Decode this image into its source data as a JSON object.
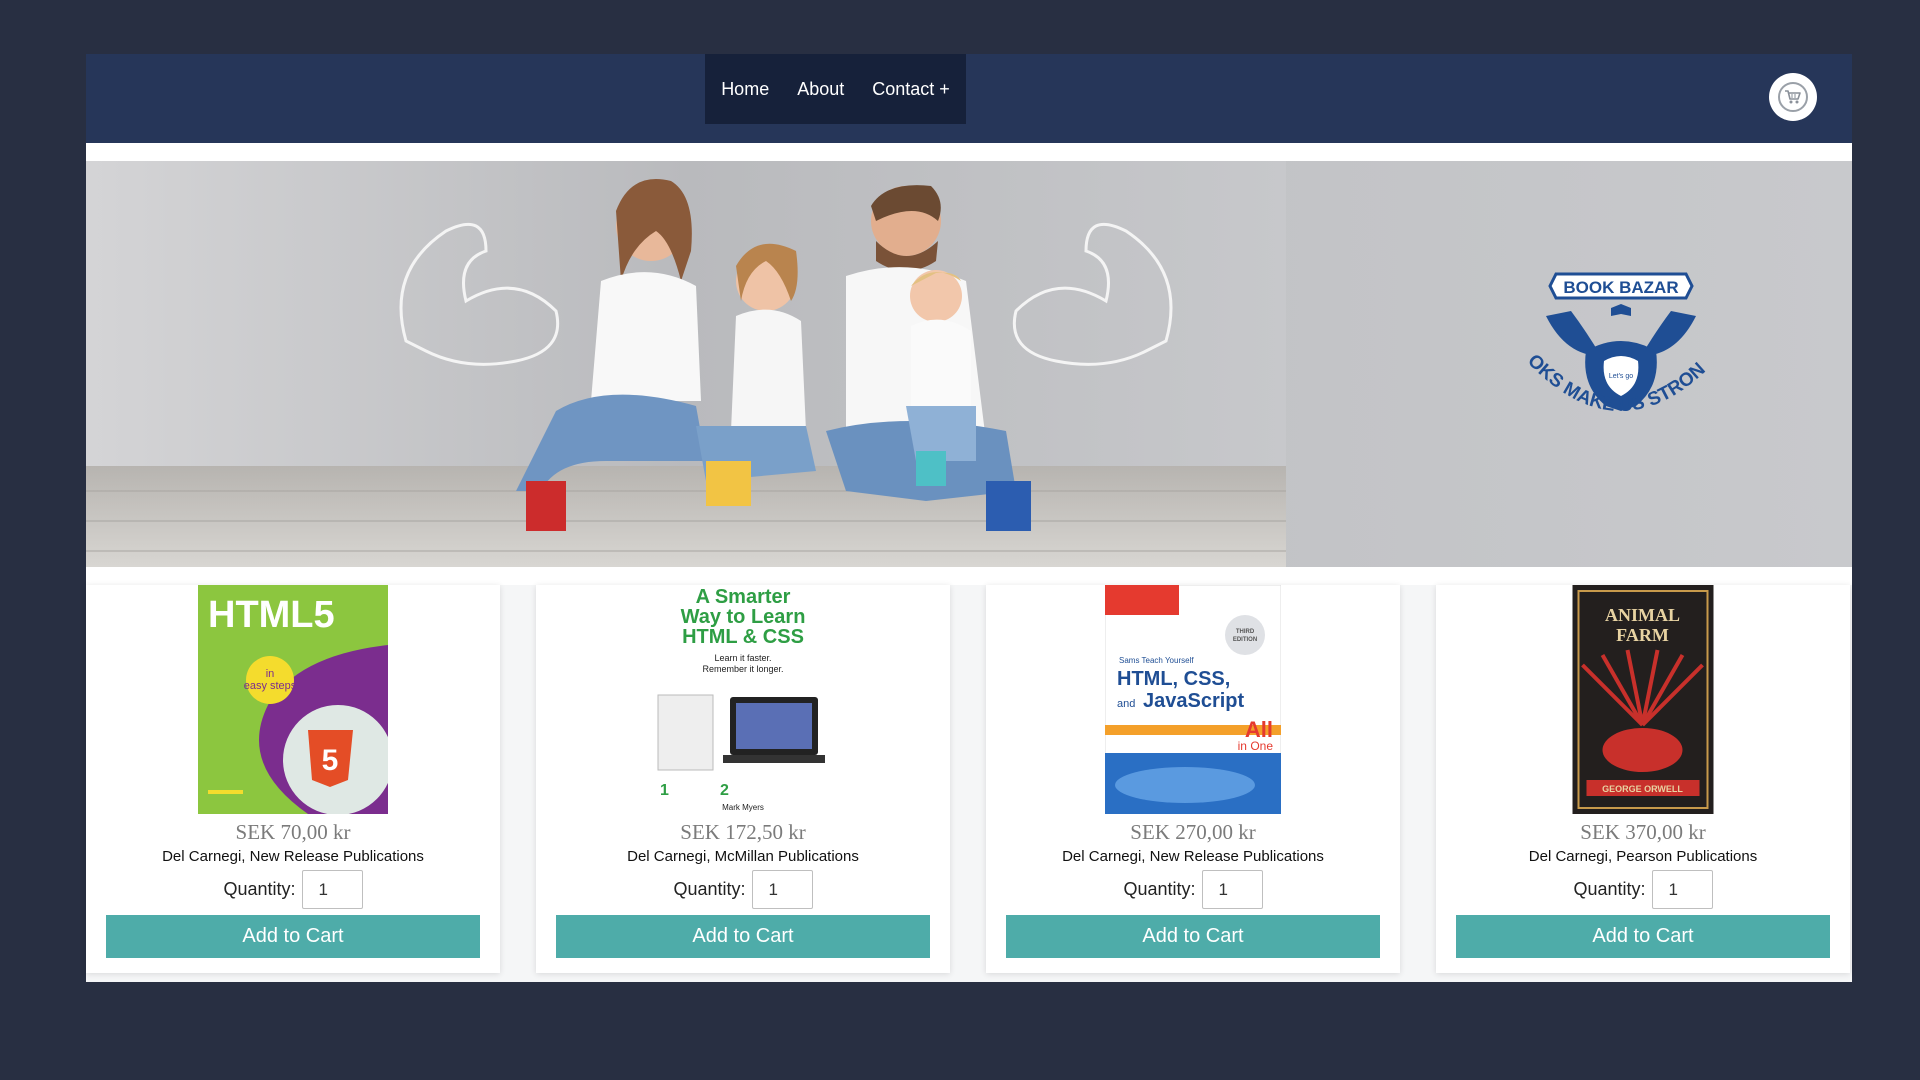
{
  "nav": {
    "items": [
      {
        "label": "Home"
      },
      {
        "label": "About"
      },
      {
        "label": "Contact +"
      }
    ]
  },
  "cart": {
    "icon": "shopping-cart-icon"
  },
  "hero": {
    "logo": {
      "name": "BOOK BAZAR",
      "tag": "Let's go",
      "slogan": "BOOKS MAKE US STRONGER"
    }
  },
  "colors": {
    "navbar": "#263659",
    "nav_menu": "#16213a",
    "page_bg": "#282f42",
    "button": "#4eaca9",
    "logo_blue": "#1f4e94"
  },
  "products": [
    {
      "price": "SEK 70,00 kr",
      "publisher": "Del Carnegi, New Release Publications",
      "quantity_label": "Quantity:",
      "quantity": "1",
      "button": "Add to Cart",
      "cover": {
        "title": "HTML5",
        "subtitle": "in easy steps",
        "badge": "5"
      }
    },
    {
      "price": "SEK 172,50 kr",
      "publisher": "Del Carnegi, McMillan Publications",
      "quantity_label": "Quantity:",
      "quantity": "1",
      "button": "Add to Cart",
      "cover": {
        "title": "A Smarter Way to Learn HTML & CSS",
        "subtitle": "Learn it faster. Remember it longer.",
        "author": "Mark Myers"
      }
    },
    {
      "price": "SEK 270,00 kr",
      "publisher": "Del Carnegi, New Release Publications",
      "quantity_label": "Quantity:",
      "quantity": "1",
      "button": "Add to Cart",
      "cover": {
        "series": "Sams Teach Yourself",
        "title": "HTML, CSS, and JavaScript",
        "badge": "All in One",
        "edition": "THIRD EDITION"
      }
    },
    {
      "price": "SEK 370,00 kr",
      "publisher": "Del Carnegi, Pearson Publications",
      "quantity_label": "Quantity:",
      "quantity": "1",
      "button": "Add to Cart",
      "cover": {
        "title": "ANIMAL FARM",
        "author": "GEORGE ORWELL"
      }
    }
  ]
}
